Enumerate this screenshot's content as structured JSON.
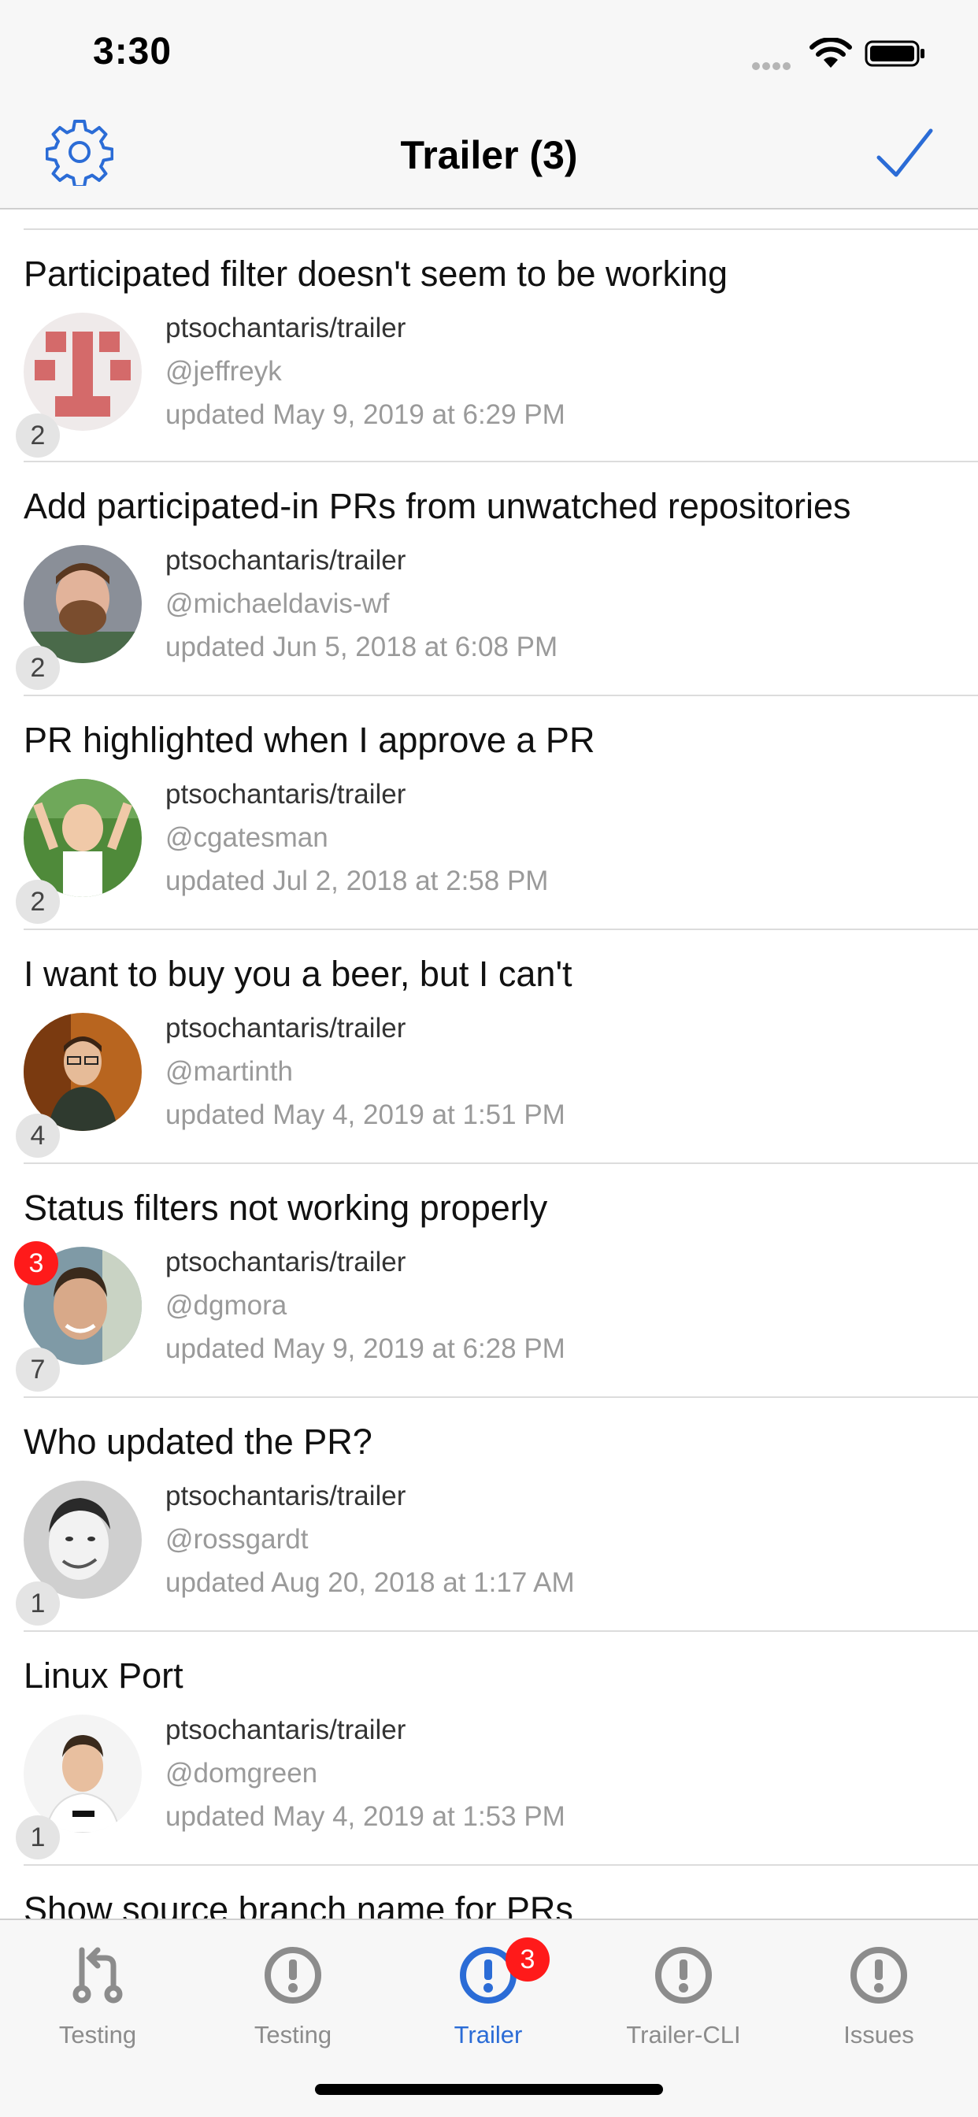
{
  "status_bar": {
    "time": "3:30"
  },
  "nav": {
    "title": "Trailer (3)"
  },
  "colors": {
    "accent": "#2b6cd6",
    "badge_red": "#ff1a1a",
    "secondary_text": "#9a9a9a"
  },
  "rows": [
    {
      "title": "Participated filter doesn't seem to be working",
      "repo": "ptsochantaris/trailer",
      "author": "@jeffreyk",
      "updated": "updated May 9, 2019 at 6:29 PM",
      "count": "2",
      "unread": ""
    },
    {
      "title": "Add participated-in PRs from unwatched repositories",
      "repo": "ptsochantaris/trailer",
      "author": "@michaeldavis-wf",
      "updated": "updated Jun 5, 2018 at 6:08 PM",
      "count": "2",
      "unread": ""
    },
    {
      "title": "PR highlighted when I approve a PR",
      "repo": "ptsochantaris/trailer",
      "author": "@cgatesman",
      "updated": "updated Jul 2, 2018 at 2:58 PM",
      "count": "2",
      "unread": ""
    },
    {
      "title": "I want to buy you a beer, but I can't",
      "repo": "ptsochantaris/trailer",
      "author": "@martinth",
      "updated": "updated May 4, 2019 at 1:51 PM",
      "count": "4",
      "unread": ""
    },
    {
      "title": "Status filters not working properly",
      "repo": "ptsochantaris/trailer",
      "author": "@dgmora",
      "updated": "updated May 9, 2019 at 6:28 PM",
      "count": "7",
      "unread": "3"
    },
    {
      "title": "Who updated the PR?",
      "repo": "ptsochantaris/trailer",
      "author": "@rossgardt",
      "updated": "updated Aug 20, 2018 at 1:17 AM",
      "count": "1",
      "unread": ""
    },
    {
      "title": "Linux Port",
      "repo": "ptsochantaris/trailer",
      "author": "@domgreen",
      "updated": "updated May 4, 2019 at 1:53 PM",
      "count": "1",
      "unread": ""
    },
    {
      "title": "Show source branch name for PRs",
      "repo": "",
      "author": "",
      "updated": "",
      "count": "",
      "unread": ""
    }
  ],
  "tabs": [
    {
      "label": "Testing",
      "icon": "pull-request-icon"
    },
    {
      "label": "Testing",
      "icon": "issue-icon"
    },
    {
      "label": "Trailer",
      "icon": "issue-icon",
      "badge": "3"
    },
    {
      "label": "Trailer-CLI",
      "icon": "issue-icon"
    },
    {
      "label": "Issues",
      "icon": "issue-icon"
    }
  ]
}
